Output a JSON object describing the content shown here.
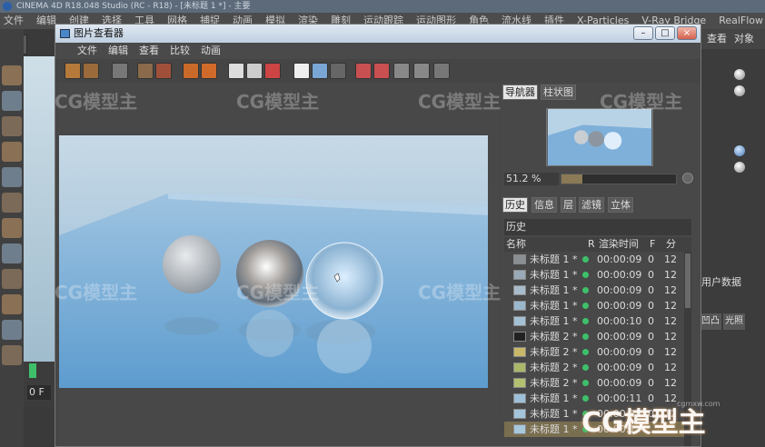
{
  "app": {
    "title": "CINEMA 4D R18.048 Studio (RC - R18) - [未标题 1 *] - 主要",
    "menu": [
      "文件",
      "编辑",
      "创建",
      "选择",
      "工具",
      "网格",
      "捕捉",
      "动画",
      "模拟",
      "渲染",
      "雕刻",
      "运动跟踪",
      "运动图形",
      "角色",
      "流水线",
      "插件",
      "X-Particles",
      "V-Ray Bridge",
      "RealFlow"
    ],
    "right_panel": {
      "tabs": [
        "查看",
        "对象"
      ],
      "user_data": "用户数据",
      "sub_tabs": [
        "凹凸",
        "光照"
      ]
    },
    "timeline": {
      "frame": "0 F"
    }
  },
  "viewer": {
    "title": "图片查看器",
    "menu": [
      "文件",
      "编辑",
      "查看",
      "比较",
      "动画"
    ],
    "side_tabs": [
      "导航器",
      "柱状图"
    ],
    "zoom": "51.2 %",
    "zoom_fraction": 0.18,
    "bottom_tabs": [
      "历史",
      "信息",
      "层",
      "滤镜",
      "立体"
    ],
    "history": {
      "title": "历史",
      "columns": {
        "name": "名称",
        "r": "R",
        "time": "渲染时间",
        "f": "F",
        "dist": "分"
      },
      "rows": [
        {
          "name": "未标题 1 *",
          "time": "00:00:09",
          "f": "0",
          "s": "12",
          "thumb": "#8a8f94"
        },
        {
          "name": "未标题 1 *",
          "time": "00:00:09",
          "f": "0",
          "s": "12",
          "thumb": "#9aa9b7"
        },
        {
          "name": "未标题 1 *",
          "time": "00:00:09",
          "f": "0",
          "s": "12",
          "thumb": "#a8bccc"
        },
        {
          "name": "未标题 1 *",
          "time": "00:00:09",
          "f": "0",
          "s": "12",
          "thumb": "#9bb7cc"
        },
        {
          "name": "未标题 1 *",
          "time": "00:00:10",
          "f": "0",
          "s": "12",
          "thumb": "#a4c0d4"
        },
        {
          "name": "未标题 2 *",
          "time": "00:00:09",
          "f": "0",
          "s": "12",
          "thumb": "#222"
        },
        {
          "name": "未标题 2 *",
          "time": "00:00:09",
          "f": "0",
          "s": "12",
          "thumb": "#c8b86a"
        },
        {
          "name": "未标题 2 *",
          "time": "00:00:09",
          "f": "0",
          "s": "12",
          "thumb": "#aab86a"
        },
        {
          "name": "未标题 2 *",
          "time": "00:00:09",
          "f": "0",
          "s": "12",
          "thumb": "#b4c070"
        },
        {
          "name": "未标题 1 *",
          "time": "00:00:11",
          "f": "0",
          "s": "12",
          "thumb": "#9dc0d8"
        },
        {
          "name": "未标题 1 *",
          "time": "00:00:11",
          "f": "0",
          "s": "12",
          "thumb": "#a3c4db"
        },
        {
          "name": "未标题 1 *",
          "time": "00:00:1",
          "f": "",
          "s": "",
          "thumb": "#a8c8dc"
        }
      ]
    }
  },
  "watermark": {
    "text": "CG模型主",
    "url": "cgmxw.com"
  },
  "colors": {
    "accent": "#3ec06a",
    "selection": "#7a6e50"
  }
}
